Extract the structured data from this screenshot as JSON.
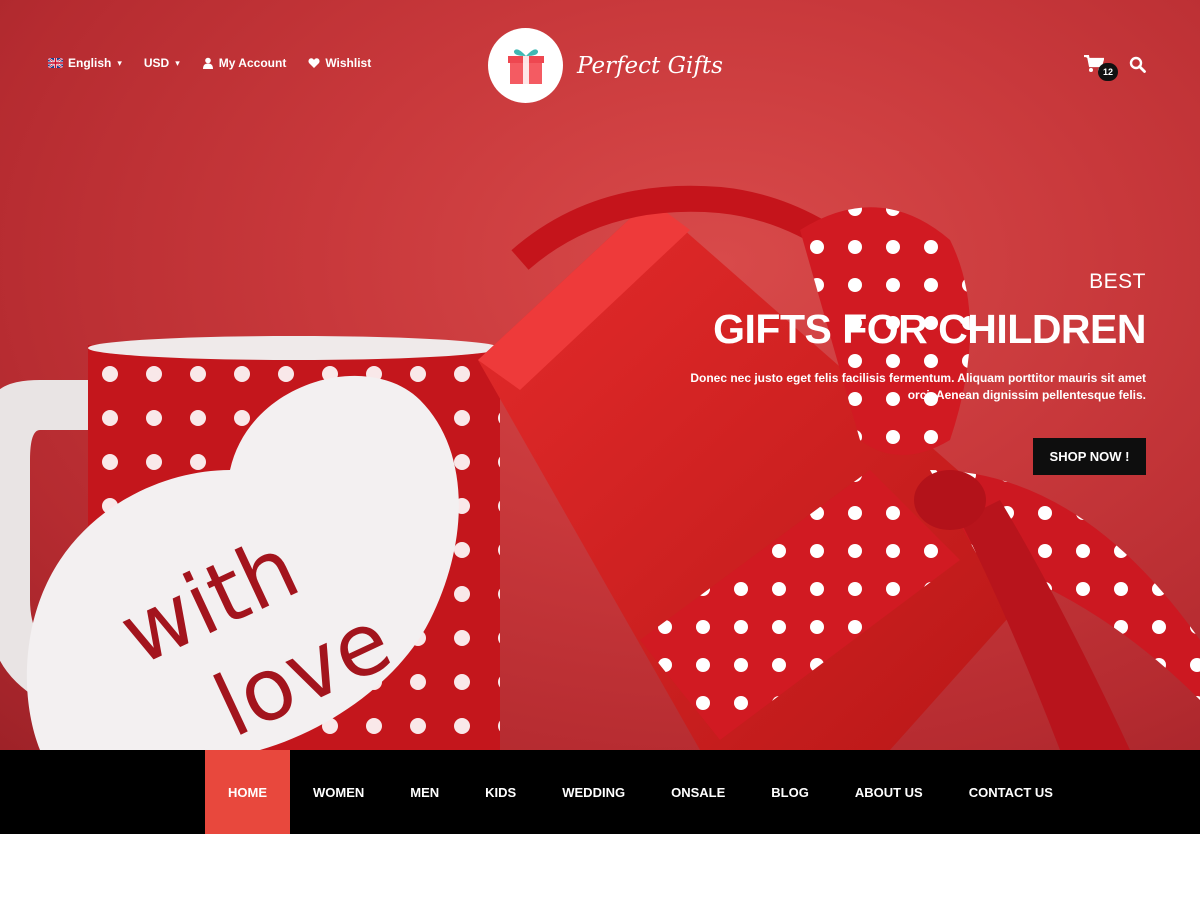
{
  "theme": {
    "accent": "#e8483d",
    "hero_red": "#c8383b",
    "nav_background": "#000000",
    "button_background": "#0e0e0e",
    "text_on_dark": "#ffffff"
  },
  "topbar": {
    "language": {
      "label": "English",
      "icon": "uk-flag-icon"
    },
    "currency": {
      "label": "USD"
    },
    "account": {
      "label": "My Account",
      "icon": "user-icon"
    },
    "wishlist": {
      "label": "Wishlist",
      "icon": "heart-icon"
    }
  },
  "logo": {
    "name": "Perfect Gifts",
    "icon": "gift-box-icon"
  },
  "cart": {
    "count": "12",
    "icon": "cart-icon"
  },
  "search": {
    "icon": "search-icon"
  },
  "slide": {
    "eyebrow": "BEST",
    "title": "GIFTS FOR CHILDREN",
    "description": "Donec nec justo eget felis facilisis fermentum. Aliquam porttitor mauris sit amet orci. Aenean dignissim pellentesque felis.",
    "cta": "SHOP NOW !",
    "image_text": "with love"
  },
  "nav": {
    "items": [
      {
        "label": "HOME",
        "active": true
      },
      {
        "label": "WOMEN",
        "active": false
      },
      {
        "label": "MEN",
        "active": false
      },
      {
        "label": "KIDS",
        "active": false
      },
      {
        "label": "WEDDING",
        "active": false
      },
      {
        "label": "ONSALE",
        "active": false
      },
      {
        "label": "BLOG",
        "active": false
      },
      {
        "label": "ABOUT US",
        "active": false
      },
      {
        "label": "CONTACT US",
        "active": false
      }
    ]
  }
}
